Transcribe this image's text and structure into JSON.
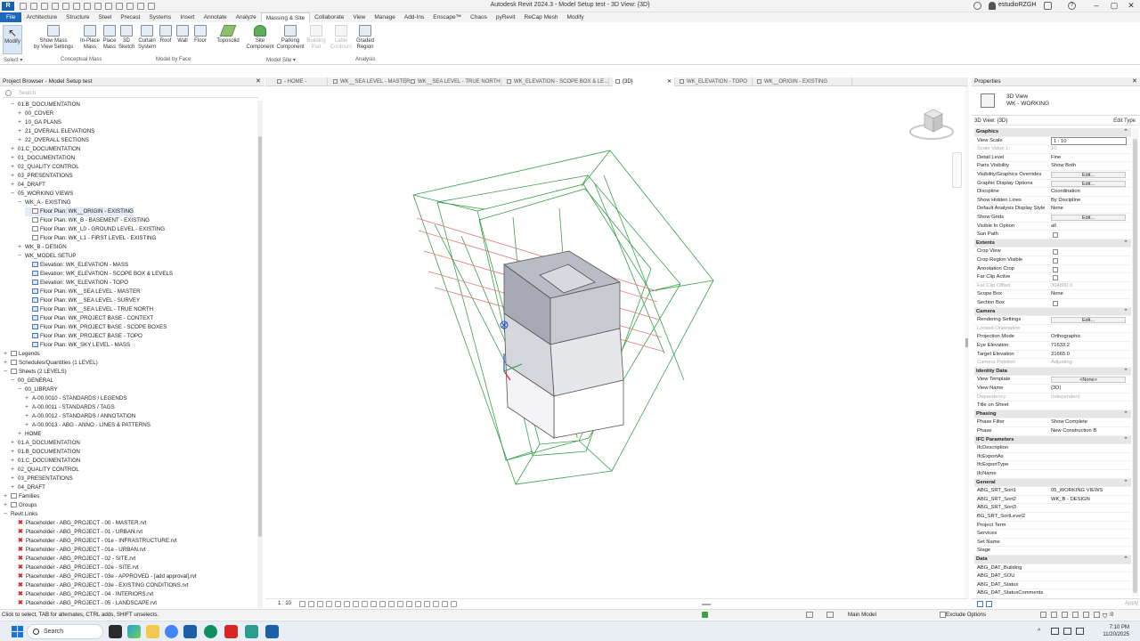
{
  "app": {
    "title": "Autodesk Revit 2024.3 - Model Setup test - 3D View: {3D}",
    "user": "estudioRZGH",
    "logo": "R"
  },
  "ribbon_tabs": [
    "File",
    "Architecture",
    "Structure",
    "Steel",
    "Precast",
    "Systems",
    "Insert",
    "Annotate",
    "Analyze",
    "Massing & Site",
    "Collaborate",
    "View",
    "Manage",
    "Add-Ins",
    "Enscape™",
    "Chaos",
    "pyRevit",
    "ReCap Mesh",
    "Modify"
  ],
  "active_tab": "Massing & Site",
  "ribbon": {
    "modify": "Modify",
    "show_mass": "Show Mass\nby View Settings",
    "in_place_mass": "In-Place\nMass",
    "place_mass": "Place\nMass",
    "sketch_3d": "3D\nSketch",
    "curtain_system": "Curtain\nSystem",
    "roof": "Roof",
    "wall": "Wall",
    "floor": "Floor",
    "toposolid": "Toposolid",
    "site_component": "Site\nComponent",
    "parking_component": "Parking\nComponent",
    "building_pad": "Building\nPad",
    "label_contours": "Label\nContours",
    "graded_region": "Graded\nRegion",
    "panels": {
      "select": "Select ▾",
      "conceptual_mass": "Conceptual Mass",
      "model_by_face": "Model by Face",
      "model_site": "Model Site ▾",
      "analysis": "Analysis"
    }
  },
  "project_browser": {
    "title": "Project Browser - Model Setup test",
    "search_placeholder": "Search",
    "items": [
      {
        "t": "−",
        "label": "01.B_DOCUMENTATION",
        "lvl": 1
      },
      {
        "t": "+",
        "label": "00_COVER",
        "lvl": 2
      },
      {
        "t": "+",
        "label": "10_GA PLANS",
        "lvl": 2
      },
      {
        "t": "+",
        "label": "21_OVERALL ELEVATIONS",
        "lvl": 2
      },
      {
        "t": "+",
        "label": "22_OVERALL SECTIONS",
        "lvl": 2
      },
      {
        "t": "+",
        "label": "01.C_DOCUMENTATION",
        "lvl": 1
      },
      {
        "t": "+",
        "label": "01_DOCUMENTATION",
        "lvl": 1
      },
      {
        "t": "+",
        "label": "02_QUALITY CONTROL",
        "lvl": 1
      },
      {
        "t": "+",
        "label": "03_PRESENTATIONS",
        "lvl": 1
      },
      {
        "t": "+",
        "label": "04_DRAFT",
        "lvl": 1
      },
      {
        "t": "−",
        "label": "05_WORKING VIEWS",
        "lvl": 1
      },
      {
        "t": "−",
        "label": "WK_A - EXISTING",
        "lvl": 2
      },
      {
        "t": "",
        "label": "Floor Plan: WK__ORIGIN - EXISTING",
        "lvl": 3,
        "icon": "plan",
        "sel": true
      },
      {
        "t": "",
        "label": "Floor Plan: WK_B - BASEMENT - EXISTING",
        "lvl": 3,
        "icon": "plan"
      },
      {
        "t": "",
        "label": "Floor Plan: WK_L0 - GROUND LEVEL - EXISTING",
        "lvl": 3,
        "icon": "plan"
      },
      {
        "t": "",
        "label": "Floor Plan: WK_L1 - FIRST LEVEL - EXISTING",
        "lvl": 3,
        "icon": "plan"
      },
      {
        "t": "+",
        "label": "WK_B - DESIGN",
        "lvl": 2
      },
      {
        "t": "−",
        "label": "WK_MODEL SETUP",
        "lvl": 2
      },
      {
        "t": "",
        "label": "Elevation: WK_ELEVATION - MASS",
        "lvl": 3,
        "icon": "view"
      },
      {
        "t": "",
        "label": "Elevation: WK_ELEVATION - SCOPE BOX & LEVELS",
        "lvl": 3,
        "icon": "view"
      },
      {
        "t": "",
        "label": "Elevation: WK_ELEVATION - TOPO",
        "lvl": 3,
        "icon": "view"
      },
      {
        "t": "",
        "label": "Floor Plan: WK__SEA LEVEL - MASTER",
        "lvl": 3,
        "icon": "view"
      },
      {
        "t": "",
        "label": "Floor Plan: WK__SEA LEVEL - SURVEY",
        "lvl": 3,
        "icon": "view"
      },
      {
        "t": "",
        "label": "Floor Plan: WK__SEA LEVEL - TRUE NORTH",
        "lvl": 3,
        "icon": "view"
      },
      {
        "t": "",
        "label": "Floor Plan: WK_PROJECT BASE - CONTEXT",
        "lvl": 3,
        "icon": "view"
      },
      {
        "t": "",
        "label": "Floor Plan: WK_PROJECT BASE - SCOPE BOXES",
        "lvl": 3,
        "icon": "view"
      },
      {
        "t": "",
        "label": "Floor Plan: WK_PROJECT BASE - TOPO",
        "lvl": 3,
        "icon": "view"
      },
      {
        "t": "",
        "label": "Floor Plan: WK_SKY LEVEL - MASS",
        "lvl": 3,
        "icon": "view"
      },
      {
        "t": "+",
        "label": "Legends",
        "lvl": 0,
        "icon": "plan"
      },
      {
        "t": "+",
        "label": "Schedules/Quantities (1 LEVEL)",
        "lvl": 0,
        "icon": "plan"
      },
      {
        "t": "−",
        "label": "Sheets (2 LEVELS)",
        "lvl": 0,
        "icon": "plan"
      },
      {
        "t": "−",
        "label": "00_GENERAL",
        "lvl": 1
      },
      {
        "t": "−",
        "label": "00_LIBRARY",
        "lvl": 2
      },
      {
        "t": "+",
        "label": "A-00.0010 - STANDARDS / LEGENDS",
        "lvl": 3
      },
      {
        "t": "+",
        "label": "A-00.0011 - STANDARDS / TAGS",
        "lvl": 3
      },
      {
        "t": "+",
        "label": "A-00.0012 - STANDARDS / ANNOTATION",
        "lvl": 3
      },
      {
        "t": "+",
        "label": "A-00.0013 - ABG - ANNO - LINES & PATTERNS",
        "lvl": 3
      },
      {
        "t": "+",
        "label": "HOME",
        "lvl": 2
      },
      {
        "t": "+",
        "label": "01.A_DOCUMENTATION",
        "lvl": 1
      },
      {
        "t": "+",
        "label": "01.B_DOCUMENTATION",
        "lvl": 1
      },
      {
        "t": "+",
        "label": "01.C_DOCUMENTATION",
        "lvl": 1
      },
      {
        "t": "+",
        "label": "02_QUALITY CONTROL",
        "lvl": 1
      },
      {
        "t": "+",
        "label": "03_PRESENTATIONS",
        "lvl": 1
      },
      {
        "t": "+",
        "label": "04_DRAFT",
        "lvl": 1
      },
      {
        "t": "+",
        "label": "Families",
        "lvl": 0,
        "icon": "plan"
      },
      {
        "t": "+",
        "label": "Groups",
        "lvl": 0,
        "icon": "plan"
      },
      {
        "t": "−",
        "label": "Revit Links",
        "lvl": 0
      },
      {
        "t": "",
        "label": "Placeholder - ABG_PROJECT - 00 - MASTER.rvt",
        "lvl": 1,
        "icon": "link"
      },
      {
        "t": "",
        "label": "Placeholder - ABG_PROJECT - 01 - URBAN.rvt",
        "lvl": 1,
        "icon": "link"
      },
      {
        "t": "",
        "label": "Placeholder - ABG_PROJECT - 01e - INFRASTRUCTURE.rvt",
        "lvl": 1,
        "icon": "link"
      },
      {
        "t": "",
        "label": "Placeholder - ABG_PROJECT - 01e - URBAN.rvt",
        "lvl": 1,
        "icon": "link"
      },
      {
        "t": "",
        "label": "Placeholder - ABG_PROJECT - 02 - SITE.rvt",
        "lvl": 1,
        "icon": "link"
      },
      {
        "t": "",
        "label": "Placeholder - ABG_PROJECT - 02e - SITE.rvt",
        "lvl": 1,
        "icon": "link"
      },
      {
        "t": "",
        "label": "Placeholder - ABG_PROJECT - 03e - APPROVED - [add approval].rvt",
        "lvl": 1,
        "icon": "link"
      },
      {
        "t": "",
        "label": "Placeholder - ABG_PROJECT - 03e - EXISTING CONDITIONS.rvt",
        "lvl": 1,
        "icon": "link"
      },
      {
        "t": "",
        "label": "Placeholder - ABG_PROJECT - 04 - INTERIORS.rvt",
        "lvl": 1,
        "icon": "link"
      },
      {
        "t": "",
        "label": "Placeholder - ABG_PROJECT - 05 - LANDSCAPE.rvt",
        "lvl": 1,
        "icon": "link"
      }
    ]
  },
  "view_tabs": [
    {
      "label": "- HOME -"
    },
    {
      "label": "WK__SEA LEVEL - MASTER"
    },
    {
      "label": "WK__SEA LEVEL - TRUE NORTH"
    },
    {
      "label": "WK_ELEVATION - SCOPE BOX & LE..."
    },
    {
      "label": "{3D}",
      "active": true
    },
    {
      "label": "WK_ELEVATION - TOPO"
    },
    {
      "label": "WK__ORIGIN - EXISTING"
    }
  ],
  "view_control": {
    "scale": "1 : 10"
  },
  "properties": {
    "title": "Properties",
    "type_name": "3D View",
    "type_sub": "WK - WORKING",
    "selector": "3D View: {3D}",
    "edit_type": "Edit Type",
    "rows": [
      {
        "type": "hdr",
        "k": "Graphics"
      },
      {
        "k": "View Scale",
        "v": "1 : 10",
        "w": "box"
      },
      {
        "k": "Scale Value  1:",
        "v": "10",
        "grey": true
      },
      {
        "k": "Detail Level",
        "v": "Fine"
      },
      {
        "k": "Parts Visibility",
        "v": "Show Both"
      },
      {
        "k": "Visibility/Graphics Overrides",
        "v": "Edit...",
        "w": "btn"
      },
      {
        "k": "Graphic Display Options",
        "v": "Edit...",
        "w": "btn"
      },
      {
        "k": "Discipline",
        "v": "Coordination"
      },
      {
        "k": "Show Hidden Lines",
        "v": "By Discipline"
      },
      {
        "k": "Default Analysis Display Style",
        "v": "None"
      },
      {
        "k": "Show Grids",
        "v": "Edit...",
        "w": "btn"
      },
      {
        "k": "Visible In Option",
        "v": "all"
      },
      {
        "k": "Sun Path",
        "v": "",
        "w": "cb"
      },
      {
        "type": "hdr",
        "k": "Extents"
      },
      {
        "k": "Crop View",
        "v": "",
        "w": "cb"
      },
      {
        "k": "Crop Region Visible",
        "v": "",
        "w": "cb"
      },
      {
        "k": "Annotation Crop",
        "v": "",
        "w": "cb"
      },
      {
        "k": "Far Clip Active",
        "v": "",
        "w": "cb"
      },
      {
        "k": "Far Clip Offset",
        "v": "304800.0",
        "grey": true
      },
      {
        "k": "Scope Box",
        "v": "None"
      },
      {
        "k": "Section Box",
        "v": "",
        "w": "cb"
      },
      {
        "type": "hdr",
        "k": "Camera"
      },
      {
        "k": "Rendering Settings",
        "v": "Edit...",
        "w": "btn"
      },
      {
        "k": "Locked Orientation",
        "v": "",
        "grey": true
      },
      {
        "k": "Projection Mode",
        "v": "Orthographic"
      },
      {
        "k": "Eye Elevation",
        "v": "71633.2"
      },
      {
        "k": "Target Elevation",
        "v": "31665.0"
      },
      {
        "k": "Camera Position",
        "v": "Adjusting",
        "grey": true
      },
      {
        "type": "hdr",
        "k": "Identity Data"
      },
      {
        "k": "View Template",
        "v": "<None>",
        "w": "btn"
      },
      {
        "k": "View Name",
        "v": "{3D}"
      },
      {
        "k": "Dependency",
        "v": "Independent",
        "grey": true
      },
      {
        "k": "Title on Sheet",
        "v": ""
      },
      {
        "type": "hdr",
        "k": "Phasing"
      },
      {
        "k": "Phase Filter",
        "v": "Show Complete"
      },
      {
        "k": "Phase",
        "v": "New Construction B"
      },
      {
        "type": "hdr",
        "k": "IFC Parameters"
      },
      {
        "k": "IfcDescription",
        "v": ""
      },
      {
        "k": "IfcExportAs",
        "v": ""
      },
      {
        "k": "IfcExportType",
        "v": ""
      },
      {
        "k": "IfcName",
        "v": ""
      },
      {
        "type": "hdr",
        "k": "General"
      },
      {
        "k": "ABG_SRT_Sort1",
        "v": "05_WORKING VIEWS"
      },
      {
        "k": "ABG_SRT_Sort2",
        "v": "WK_B - DESIGN"
      },
      {
        "k": "ABG_SRT_Sort3",
        "v": ""
      },
      {
        "k": "BG_SRT_SortLevel2",
        "v": ""
      },
      {
        "k": "Project Term",
        "v": ""
      },
      {
        "k": "Services",
        "v": ""
      },
      {
        "k": "Set Name",
        "v": ""
      },
      {
        "k": "Stage",
        "v": ""
      },
      {
        "type": "hdr",
        "k": "Data"
      },
      {
        "k": "ABG_DAT_Building",
        "v": ""
      },
      {
        "k": "ABG_DAT_SOU",
        "v": ""
      },
      {
        "k": "ABG_DAT_Status",
        "v": ""
      },
      {
        "k": "ABG_DAT_StatusComments",
        "v": ""
      }
    ],
    "apply": "Apply"
  },
  "statusbar": {
    "hint": "Click to select, TAB for alternates, CTRL adds, SHIFT unselects.",
    "model": "Main Model",
    "exclude": "Exclude Options",
    "filter_count": ":0"
  },
  "taskbar": {
    "search": "Search",
    "time": "7:10 PM",
    "date": "11/20/2025"
  },
  "colors": {
    "accent": "#1d69b9",
    "scope_box": "#3aa04a",
    "level": "#e06a6a"
  },
  "icons": [
    "select-arrow-icon",
    "mass-icon",
    "roof-icon",
    "wall-icon",
    "floor-icon",
    "toposolid-icon",
    "tree-icon",
    "parking-icon",
    "viewcube-icon",
    "windows-icon",
    "search-icon",
    "help-icon",
    "user-icon"
  ]
}
